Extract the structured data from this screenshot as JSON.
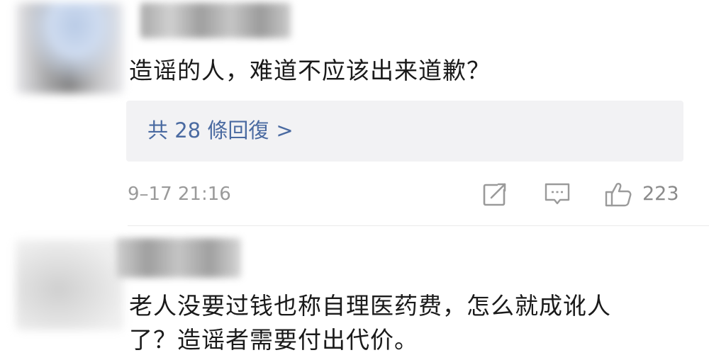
{
  "comments": [
    {
      "text": "造谣的人，难道不应该出来道歉？",
      "replies_label": "共 28 條回復",
      "replies_arrow": ">",
      "timestamp": "9–17 21:16",
      "like_count": "223"
    },
    {
      "text_line_1": "老人没要过钱也称自理医药费，怎么就成讹人",
      "text_line_2": "了？造谣者需要付出代价。"
    }
  ],
  "colors": {
    "link": "#4a6aa1",
    "meta": "#9a9a9a",
    "reply_box_bg": "#f2f2f4"
  },
  "icons": {
    "share": "share-icon",
    "reply": "comment-icon",
    "like": "thumbs-up-icon"
  }
}
